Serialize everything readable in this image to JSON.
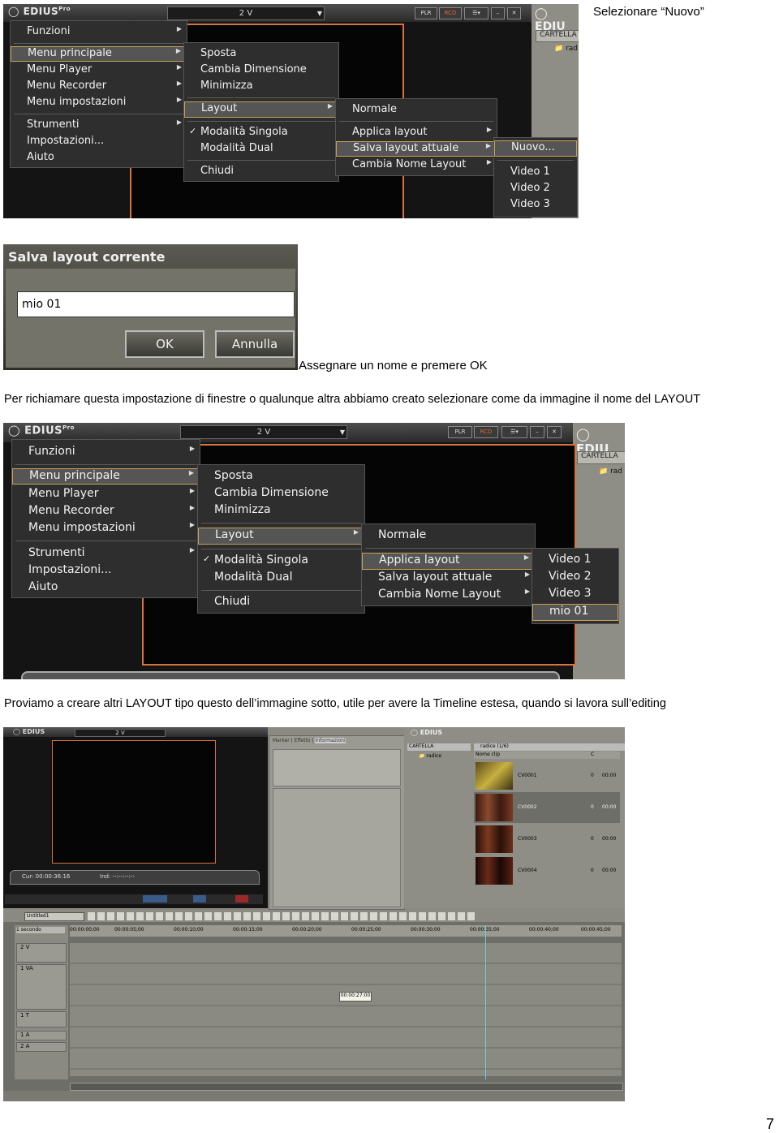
{
  "doc": {
    "caption1": "Selezionare “Nuovo”",
    "caption2": "Assegnare un nome e premere OK",
    "para1": "Per richiamare questa impostazione di finestre o qualunque altra abbiamo creato selezionare come da immagine il nome del LAYOUT",
    "para2": "Proviamo a creare altri LAYOUT tipo questo dell’immagine sotto, utile per avere la Timeline estesa, quando si lavora sull’editing",
    "page_number": "7"
  },
  "edius": {
    "logo": "EDIUS",
    "logo_sup": "Pro",
    "combo": "2 V",
    "plr": "PLR",
    "rcd": "RCD",
    "right_logo": "EDIU",
    "right_logo2": "EDIUS",
    "cartella": "CARTELLA",
    "radice_short": "rad",
    "radice_short2": "radi"
  },
  "menu_main": {
    "funzioni": "Funzioni",
    "menu_principale": "Menu principale",
    "menu_player": "Menu Player",
    "menu_recorder": "Menu Recorder",
    "menu_impostazioni": "Menu impostazioni",
    "strumenti": "Strumenti",
    "impostazioni": "Impostazioni...",
    "aiuto": "Aiuto"
  },
  "menu_sub": {
    "sposta": "Sposta",
    "cambia_dimensione": "Cambia Dimensione",
    "minimizza": "Minimizza",
    "layout": "Layout",
    "modalita_singola": "Modalità Singola",
    "modalita_dual": "Modalità Dual",
    "chiudi": "Chiudi"
  },
  "menu_layout": {
    "normale": "Normale",
    "applica_layout": "Applica layout",
    "salva_layout_attuale": "Salva layout attuale",
    "cambia_nome_layout": "Cambia Nome Layout"
  },
  "menu_salva": {
    "nuovo": "Nuovo...",
    "video1": "Video 1",
    "video2": "Video 2",
    "video3": "Video 3"
  },
  "menu_applica": {
    "video1": "Video 1",
    "video2": "Video 2",
    "video3": "Video 3",
    "mio01": "mio 01"
  },
  "dialog": {
    "title": "Salva layout corrente",
    "input_value": "mio 01",
    "ok": "OK",
    "annulla": "Annulla"
  },
  "editor": {
    "logo": "EDIUS",
    "combo": "2 V",
    "tabs": [
      "Marker",
      "Effetto",
      "Informazioni"
    ],
    "cartella": "CARTELLA",
    "radice": "radice",
    "bin_title": "radice (1/6)",
    "col_name": "Nome clip",
    "col_c": "C",
    "clips": [
      {
        "name": "CV0001",
        "c": "0",
        "tc": "00:00"
      },
      {
        "name": "CV0002",
        "c": "0",
        "tc": "00:00"
      },
      {
        "name": "CV0003",
        "c": "0",
        "tc": "00:00"
      },
      {
        "name": "CV0004",
        "c": "0",
        "tc": "00:00"
      }
    ],
    "cur_label": "Cur:",
    "cur_value": "00:00:36:16",
    "ins_label": "Ind:",
    "ins_value": "--:--:--:--",
    "sequence": "Untitled1",
    "scale": "1 secondo",
    "tracks": [
      "2 V",
      "1 VA",
      "1 T",
      "1 A",
      "2 A"
    ],
    "ruler": [
      "00:00:00;00",
      "00:00:05;00",
      "00:00:10;00",
      "00:00:15;00",
      "00:00:20;00",
      "00:00:25;00",
      "00:00:30;00",
      "00:00:35;00",
      "00:00:40;00",
      "00:00:45;00"
    ],
    "playhead_tc": "00:00:27:00"
  },
  "colors": {
    "menu_bg": "#2e2e2e",
    "highlight_border": "#c7a255",
    "monitor_border": "#d8733a",
    "pane_gray": "#8e8e86"
  }
}
